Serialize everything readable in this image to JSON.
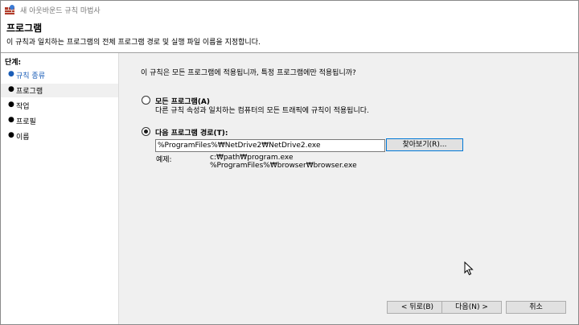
{
  "window": {
    "title": "새 아웃바운드 규칙 마법사"
  },
  "header": {
    "title": "프로그램",
    "description": "이 규칙과 일치하는 프로그램의 전체 프로그램 경로 및 실행 파일 이름을 지정합니다."
  },
  "sidebar": {
    "title": "단계:",
    "steps": [
      {
        "label": "규칙 종류",
        "state": "link"
      },
      {
        "label": "프로그램",
        "state": "active"
      },
      {
        "label": "작업",
        "state": "normal"
      },
      {
        "label": "프로필",
        "state": "normal"
      },
      {
        "label": "이름",
        "state": "normal"
      }
    ]
  },
  "main": {
    "question": "이 규칙은 모든 프로그램에 적용됩니까, 특정 프로그램에만 적용됩니까?",
    "option_all": {
      "label": "모든 프로그램(A)",
      "description": "다른 규칙 속성과 일치하는 컴퓨터의 모든 트래픽에 규칙이 적용됩니다.",
      "checked": false
    },
    "option_path": {
      "label": "다음 프로그램 경로(T):",
      "checked": true,
      "value": "%ProgramFiles%₩NetDrive2₩NetDrive2.exe",
      "browse_label": "찾아보기(R)..."
    },
    "example": {
      "label": "예제:",
      "lines": [
        "c:₩path₩program.exe",
        "%ProgramFiles%₩browser₩browser.exe"
      ]
    }
  },
  "footer": {
    "back_label": "< 뒤로(B)",
    "next_label": "다음(N) >",
    "cancel_label": "취소"
  }
}
